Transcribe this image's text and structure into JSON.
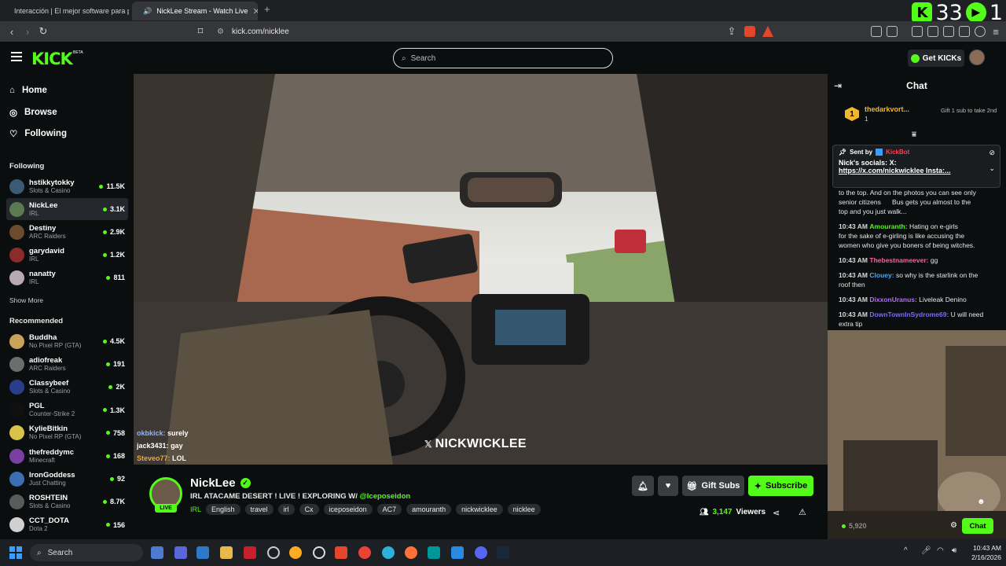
{
  "browser": {
    "tabs": [
      {
        "label": "Interacción | El mejor software para p"
      },
      {
        "label": "NickLee Stream - Watch Live"
      }
    ],
    "url": "kick.com/nicklee"
  },
  "score_overlay": {
    "left": "33",
    "right": "1"
  },
  "header": {
    "logo": "KICK",
    "beta": "BETA",
    "search_placeholder": "Search",
    "get_kicks": "Get KICKs"
  },
  "sidebar": {
    "nav": [
      {
        "label": "Home",
        "icon": "home-icon"
      },
      {
        "label": "Browse",
        "icon": "compass-icon"
      },
      {
        "label": "Following",
        "icon": "heart-icon"
      }
    ],
    "following_title": "Following",
    "following": [
      {
        "name": "hstikkytokky",
        "category": "Slots & Casino",
        "viewers": "11.5K",
        "color": "#3c5a73"
      },
      {
        "name": "NickLee",
        "category": "IRL",
        "viewers": "3.1K",
        "color": "#5b7a50",
        "selected": true
      },
      {
        "name": "Destiny",
        "category": "ARC Raiders",
        "viewers": "2.9K",
        "color": "#6b4c2e"
      },
      {
        "name": "garydavid",
        "category": "IRL",
        "viewers": "1.2K",
        "color": "#8c2b2b"
      },
      {
        "name": "nanatty",
        "category": "IRL",
        "viewers": "811",
        "color": "#b8a9b0"
      }
    ],
    "show_more": "Show More",
    "recommended_title": "Recommended",
    "recommended": [
      {
        "name": "Buddha",
        "category": "No Pixel RP (GTA)",
        "viewers": "4.5K",
        "color": "#c9a35a"
      },
      {
        "name": "adiofreak",
        "category": "ARC Raiders",
        "viewers": "191",
        "color": "#6d6d6d"
      },
      {
        "name": "Classybeef",
        "category": "Slots & Casino",
        "viewers": "2K",
        "color": "#2b3d8a"
      },
      {
        "name": "PGL",
        "category": "Counter-Strike 2",
        "viewers": "1.3K",
        "color": "#101010"
      },
      {
        "name": "KylieBitkin",
        "category": "No Pixel RP (GTA)",
        "viewers": "758",
        "color": "#d9c24a"
      },
      {
        "name": "thefreddymc",
        "category": "Minecraft",
        "viewers": "168",
        "color": "#7a3fa3"
      },
      {
        "name": "IronGoddess",
        "category": "Just Chatting",
        "viewers": "92",
        "color": "#3b6fb0"
      },
      {
        "name": "ROSHTEIN",
        "category": "Slots & Casino",
        "viewers": "8.7K",
        "color": "#5a5a5a"
      },
      {
        "name": "CCT_DOTA",
        "category": "Dota 2",
        "viewers": "156",
        "color": "#d0d0d0"
      }
    ]
  },
  "video": {
    "overlay_chat": [
      {
        "user": "okbkick:",
        "text": "surely",
        "color": "#8bb4ff"
      },
      {
        "user": "jack3431:",
        "text": "gay",
        "color": "#ffffff"
      },
      {
        "user": "Steveo77:",
        "text": "LOL",
        "color": "#f0a63a"
      }
    ],
    "watermark": "NICKWICKLEE"
  },
  "stream_info": {
    "name": "NickLee",
    "live": "LIVE",
    "title": "IRL ATACAME DESERT ! LIVE ! EXPLORING W/ ",
    "title_mention": "@Iceposeidon",
    "category": "IRL",
    "tags": [
      "English",
      "travel",
      "irl",
      "Cx",
      "iceposeidon",
      "AC7",
      "amouranth",
      "nickwicklee",
      "nicklee"
    ],
    "gift_subs": "Gift Subs",
    "subscribe": "Subscribe",
    "viewers": "3,147",
    "viewers_label": "Viewers"
  },
  "chat": {
    "title": "Chat",
    "gifter": {
      "rank": "1",
      "name": "thedarkvort...",
      "count": "1"
    },
    "gift_prompt": "Gift 1 sub to take 2nd",
    "pinned": {
      "sent_by": "Sent by",
      "bot": "KickBot",
      "text1": "Nick's socials: X:",
      "text2": "https://x.com/nickwicklee Insta:..."
    },
    "messages": [
      {
        "ts": "",
        "user": "",
        "text": "to the top. And on the photos you can see only",
        "color": "#fff"
      },
      {
        "ts": "",
        "user": "",
        "text": "senior citizens      Bus gets you almost to the",
        "color": "#fff"
      },
      {
        "ts": "",
        "user": "",
        "text": "top and you just walk...",
        "color": "#fff"
      },
      {
        "ts": "10:43 AM",
        "user": "Amouranth:",
        "text": "Hating on e-girls",
        "color": "#53fc18"
      },
      {
        "ts": "",
        "user": "",
        "text": "for the sake of e-girling is like accusing the",
        "color": "#fff"
      },
      {
        "ts": "",
        "user": "",
        "text": "women who give you boners of being witches.",
        "color": "#fff"
      },
      {
        "ts": "10:43 AM",
        "user": "Thebestnameever:",
        "text": "gg",
        "color": "#ff5ea3"
      },
      {
        "ts": "10:43 AM",
        "user": "Clouey:",
        "text": "so why is the starlink on the",
        "color": "#4da3ff"
      },
      {
        "ts": "",
        "user": "",
        "text": "roof then",
        "color": "#fff"
      },
      {
        "ts": "10:43 AM",
        "user": "DixxonUranus:",
        "text": "Liveleak Denino",
        "color": "#b36bff"
      },
      {
        "ts": "10:43 AM",
        "user": "DownTownInSydrome69:",
        "text": "U will need",
        "color": "#7a6bff"
      },
      {
        "ts": "",
        "user": "",
        "text": "extra tip",
        "color": "#fff"
      }
    ],
    "kicks_balance": "5,920",
    "chat_button": "Chat"
  },
  "taskbar": {
    "search": "Search",
    "time": "10:43 AM",
    "date": "2/16/2026"
  }
}
